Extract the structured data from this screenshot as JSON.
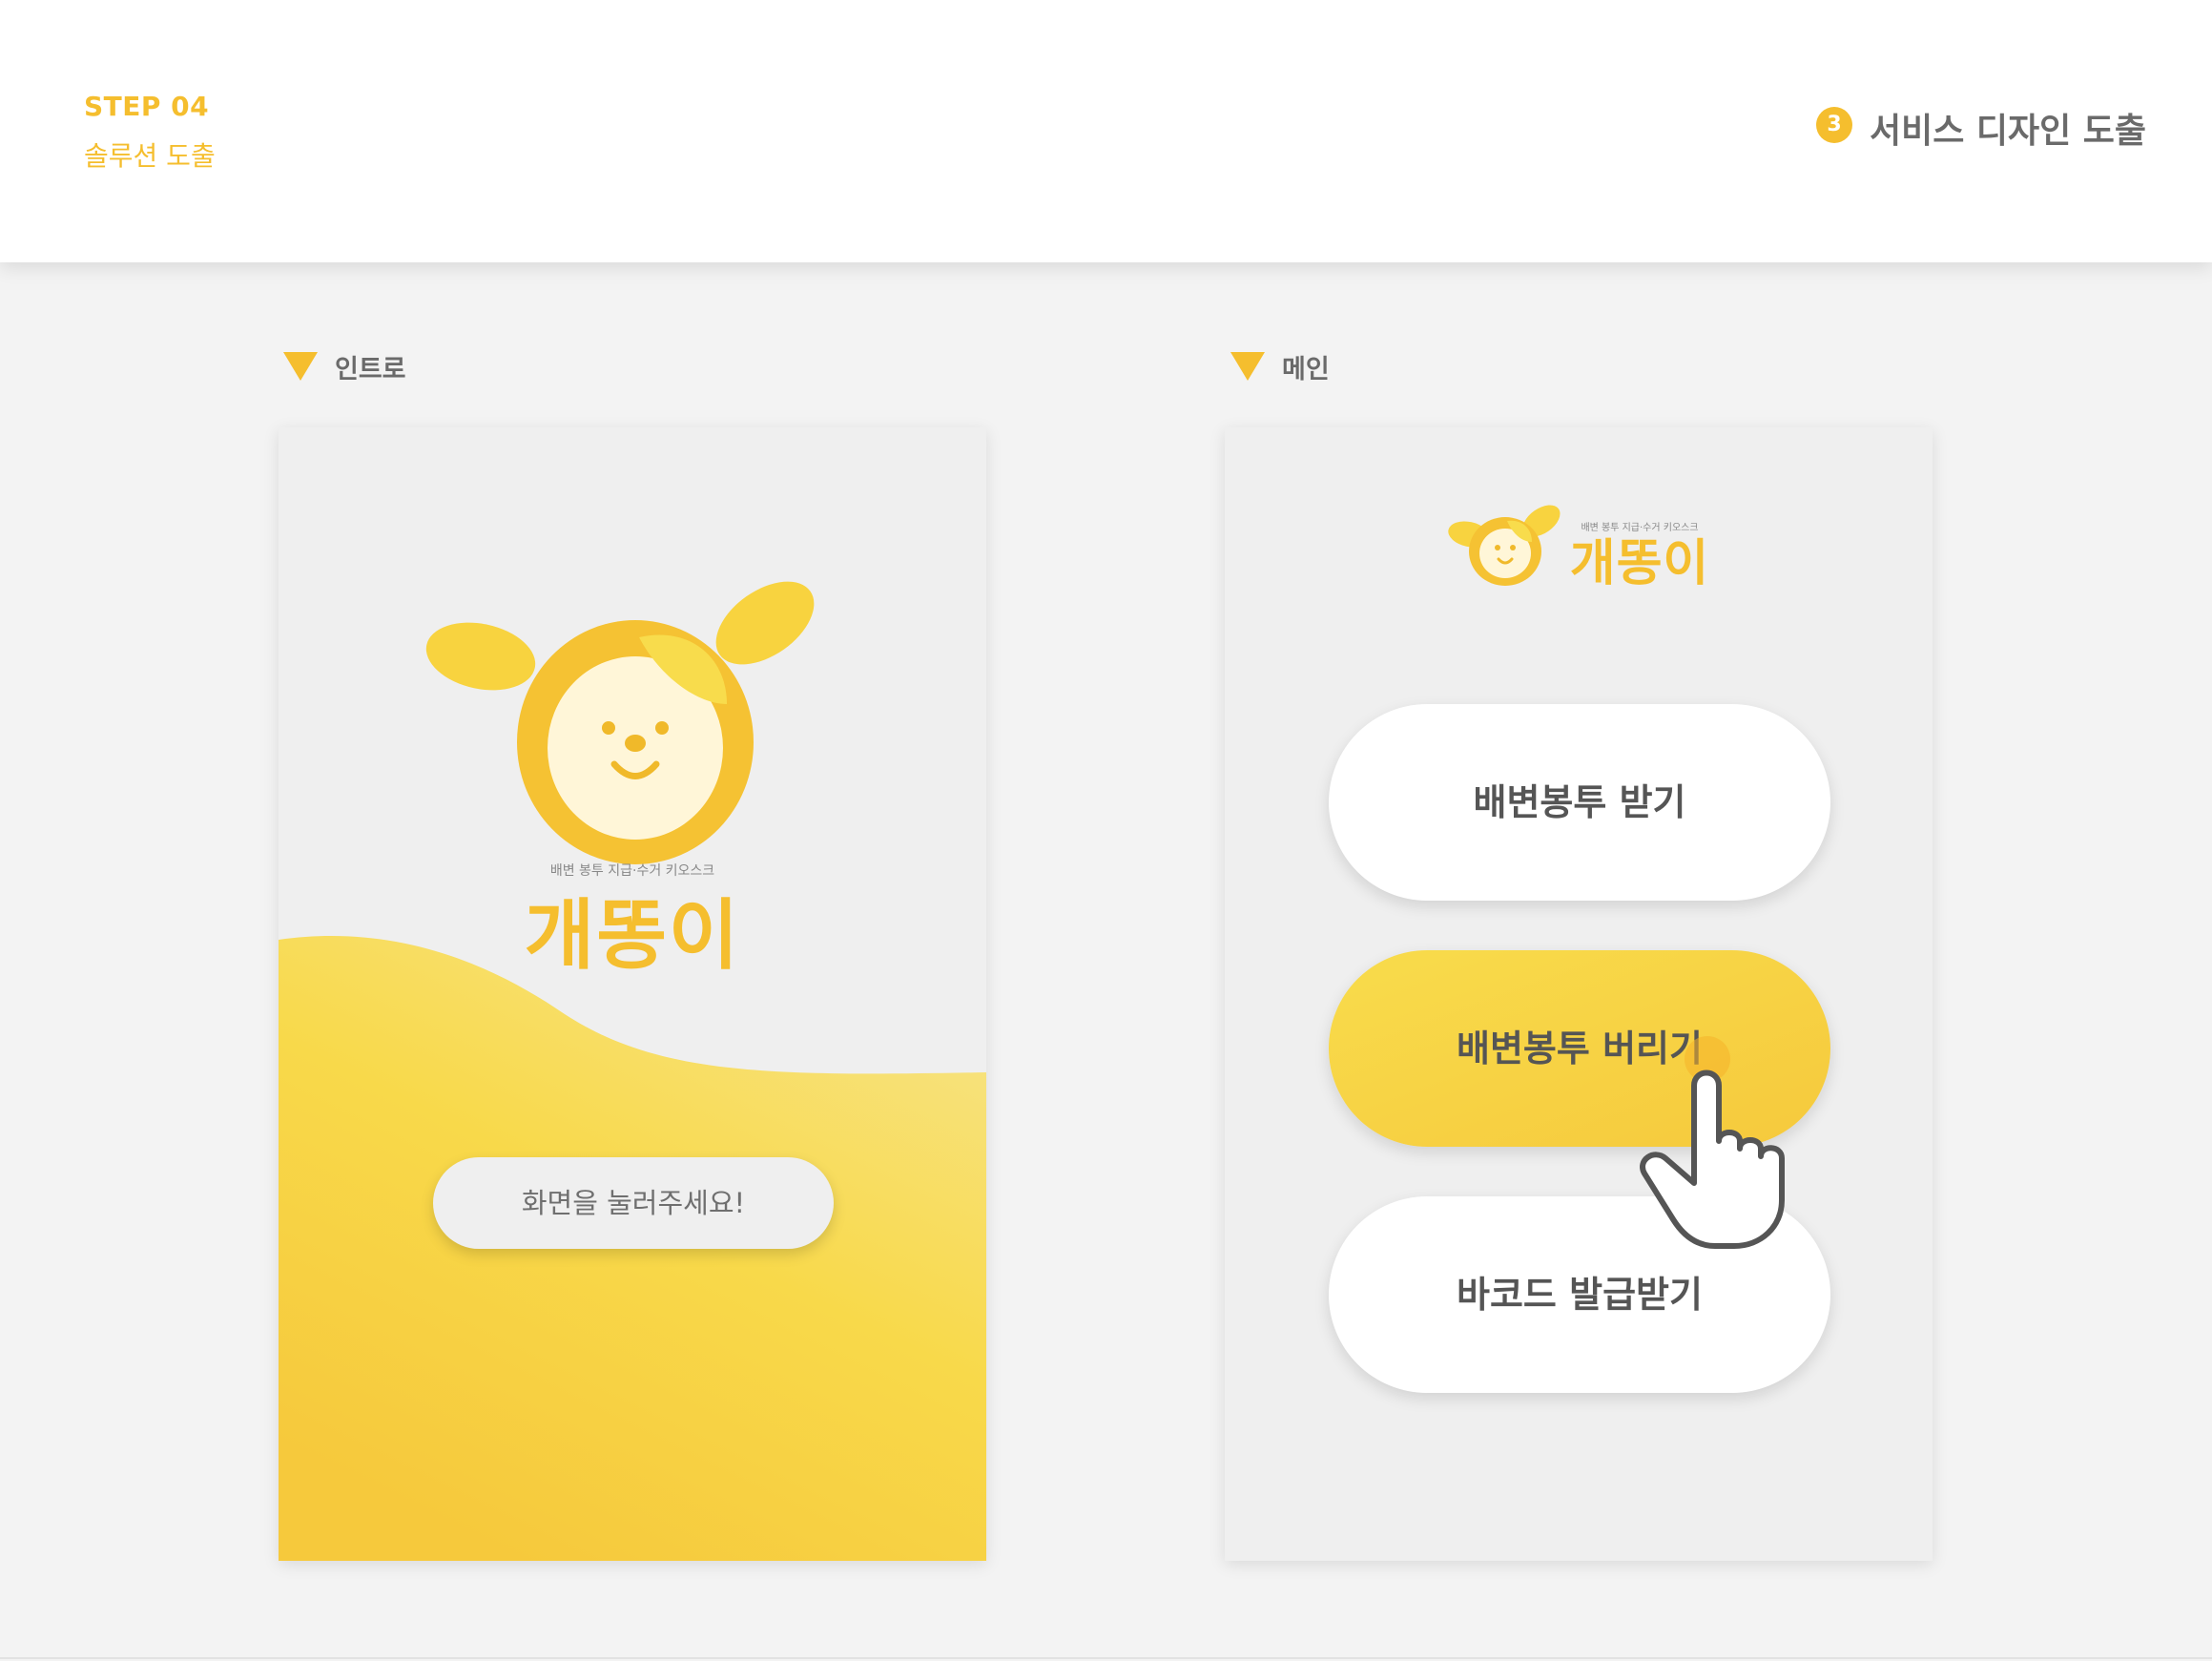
{
  "header": {
    "step_label": "STEP 04",
    "step_title": "솔루션 도출",
    "section_number": "3",
    "section_title": "서비스 디자인 도출"
  },
  "intro": {
    "label": "인트로",
    "brand_subtitle": "배변 봉투 지급·수거 키오스크",
    "brand_name": "개똥이",
    "tap_button": "화면을 눌러주세요!"
  },
  "main": {
    "label": "메인",
    "brand_subtitle": "배변 봉투 지급·수거 키오스크",
    "brand_name": "개똥이",
    "buttons": [
      {
        "label": "배변봉투 받기"
      },
      {
        "label": "배변봉투 버리기"
      },
      {
        "label": "바코드 발급받기"
      }
    ]
  },
  "colors": {
    "accent": "#f5be2e",
    "accent_light": "#f8dc4c",
    "text_gray": "#6a6a6a",
    "background": "#f3f3f3"
  },
  "icons": [
    "triangle-marker-icon",
    "mascot-dog-icon",
    "hand-pointer-icon"
  ]
}
